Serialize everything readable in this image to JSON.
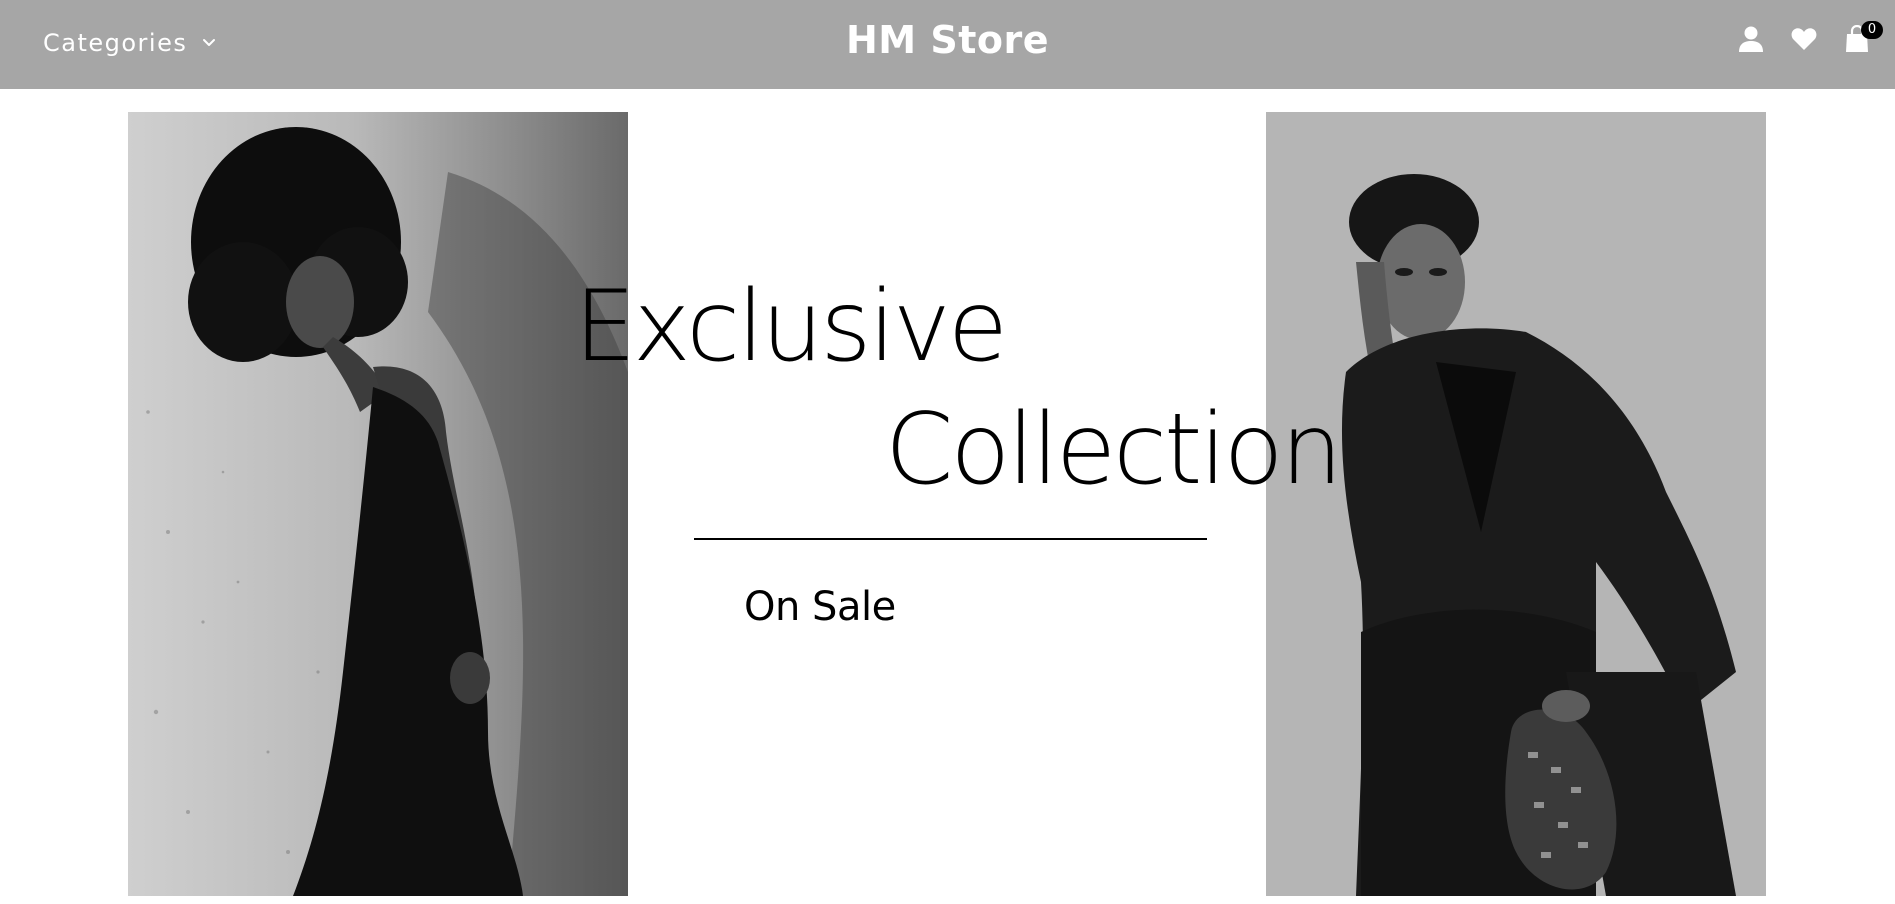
{
  "header": {
    "categories_label": "Categories",
    "brand": "HM Store",
    "cart_count": "0",
    "background_color": "#a6a6a6"
  },
  "icons": {
    "categories_toggle": "chevron-down-icon",
    "account": "user-icon",
    "wishlist": "heart-icon",
    "cart": "shopping-bag-icon"
  },
  "hero": {
    "line1": "Exclusive",
    "line2": "Collection",
    "cta": "On Sale",
    "left_photo_subject": "woman in black dress",
    "right_photo_subject": "man in dark suit with bag"
  }
}
